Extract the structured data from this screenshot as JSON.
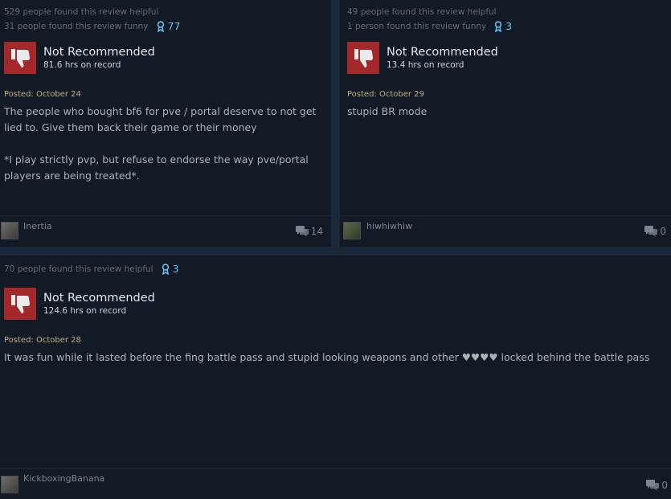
{
  "reviews": [
    {
      "helpful": "529 people found this review helpful",
      "funny": "31 people found this review funny",
      "awards": "77",
      "rating": "Not Recommended",
      "hours": "81.6 hrs on record",
      "posted": "Posted: October 24",
      "text": [
        "The people who bought bf6 for pve / portal deserve to not get lied to. Give them back their game or their money",
        "",
        "*I play strictly pvp, but refuse to endorse the way pve/portal players are being treated*."
      ],
      "user": "Inertia",
      "comments": "14"
    },
    {
      "helpful": "49 people found this review helpful",
      "funny": "1 person found this review funny",
      "awards": "3",
      "rating": "Not Recommended",
      "hours": "13.4 hrs on record",
      "posted": "Posted: October 29",
      "text": [
        "stupid BR mode"
      ],
      "user": "hiwhiwhiw",
      "comments": "0"
    },
    {
      "helpful": "70 people found this review helpful",
      "awards": "3",
      "rating": "Not Recommended",
      "hours": "124.6 hrs on record",
      "posted": "Posted: October 28",
      "text": [
        "It was fun while it lasted before the fing battle pass and stupid looking weapons and other ♥♥♥♥ locked behind the battle pass"
      ],
      "user": "KickboxingBanana",
      "comments": "0"
    }
  ],
  "icons": {
    "award": "award-ribbon-icon",
    "thumb": "thumbs-down-icon",
    "comment": "comment-bubble-icon"
  },
  "colors": {
    "background": "#1b2838",
    "card": "#111a25",
    "not_recommended": "#a3282a",
    "award": "#66c0f4",
    "posted": "#c2ad84"
  }
}
